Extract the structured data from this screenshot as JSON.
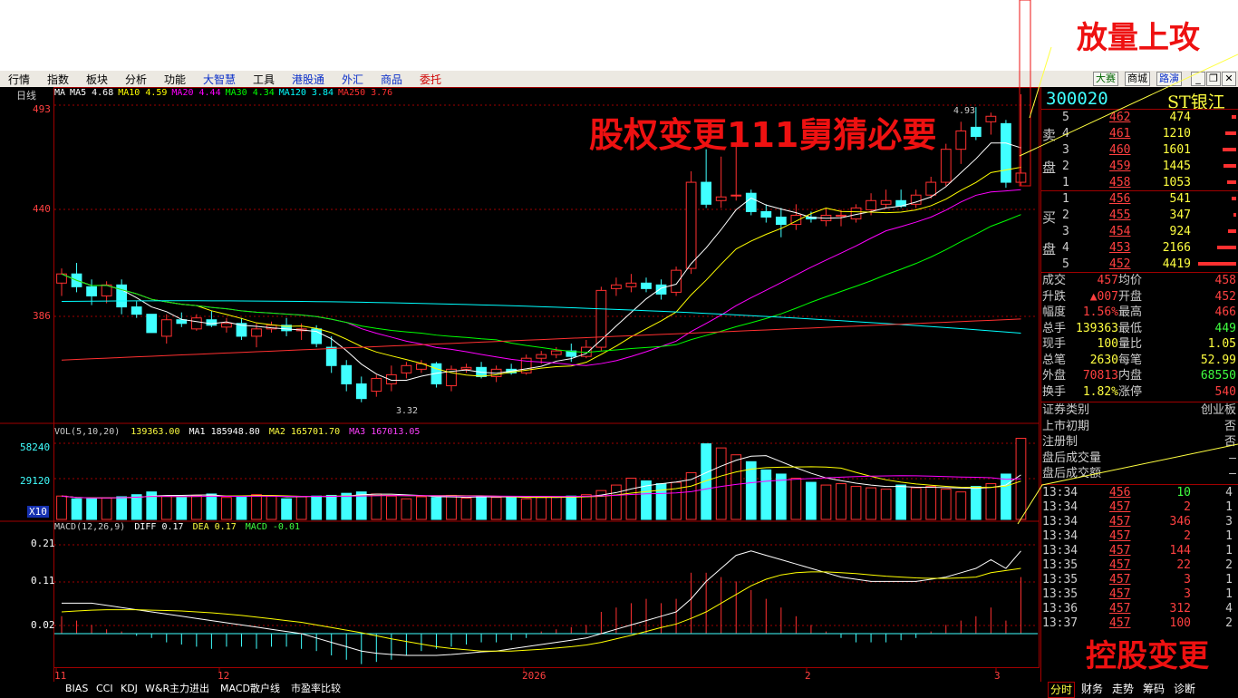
{
  "menu": {
    "items": [
      {
        "label": "行情",
        "style": "normal"
      },
      {
        "label": "指数",
        "style": "normal"
      },
      {
        "label": "板块",
        "style": "normal"
      },
      {
        "label": "分析",
        "style": "normal"
      },
      {
        "label": "功能",
        "style": "normal"
      },
      {
        "label": "大智慧",
        "style": "blue"
      },
      {
        "label": "工具",
        "style": "normal"
      },
      {
        "label": "港股通",
        "style": "blue"
      },
      {
        "label": "外汇",
        "style": "blue"
      },
      {
        "label": "商品",
        "style": "blue"
      },
      {
        "label": "委托",
        "style": "red"
      }
    ],
    "right_buttons": [
      "大赛",
      "商城",
      "路演"
    ],
    "window_controls": [
      "_",
      "❐",
      "✕"
    ]
  },
  "overlay": {
    "top_right": "放量上攻",
    "center": "股权变更111舅猜必要",
    "bottom_right": "控股变更"
  },
  "kline": {
    "period_label": "日线",
    "ma_legend": [
      {
        "label": "MA",
        "value": "",
        "color": "#ffffff"
      },
      {
        "label": "MA5",
        "value": "4.68",
        "color": "#ffffff"
      },
      {
        "label": "MA10",
        "value": "4.59",
        "color": "#ffff00"
      },
      {
        "label": "MA20",
        "value": "4.44",
        "color": "#ff00ff"
      },
      {
        "label": "MA30",
        "value": "4.34",
        "color": "#00ff00"
      },
      {
        "label": "MA120",
        "value": "3.84",
        "color": "#00ffff"
      },
      {
        "label": "MA250",
        "value": "3.76",
        "color": "#ff3030"
      }
    ],
    "price_ticks": [
      "493",
      "440",
      "386"
    ],
    "high_label": "4.93",
    "low_label": "3.32"
  },
  "volume": {
    "legend": {
      "title": "VOL(5,10,20)",
      "vol": "139363.00",
      "ma1_label": "MA1",
      "ma1": "185948.80",
      "ma2_label": "MA2",
      "ma2": "165701.70",
      "ma3_label": "MA3",
      "ma3": "167013.05"
    },
    "ticks": [
      "58240",
      "29120"
    ],
    "unit": "X10"
  },
  "macd": {
    "legend": {
      "title": "MACD(12,26,9)",
      "diff_label": "DIFF",
      "diff": "0.17",
      "dea_label": "DEA",
      "dea": "0.17",
      "macd_label": "MACD",
      "macd": "-0.01"
    },
    "ticks": [
      "0.21",
      "0.11",
      "0.02"
    ]
  },
  "x_axis": {
    "labels": [
      "11",
      "12",
      "2026",
      "2",
      "3"
    ]
  },
  "bottom_tabs": [
    "BIAS",
    "CCI",
    "KDJ",
    "W&R",
    "主力进出",
    "MACD",
    "散户线",
    "市盈率比较"
  ],
  "right_tabs": [
    "分时",
    "财务",
    "走势",
    "筹码",
    "诊断"
  ],
  "quote": {
    "code": "300020",
    "name": "ST银江",
    "sell_label": [
      "卖",
      "盘"
    ],
    "buy_label": [
      "买",
      "盘"
    ],
    "sell": [
      {
        "level": "5",
        "price": "462",
        "vol": "474"
      },
      {
        "level": "4",
        "price": "461",
        "vol": "1210"
      },
      {
        "level": "3",
        "price": "460",
        "vol": "1601"
      },
      {
        "level": "2",
        "price": "459",
        "vol": "1445"
      },
      {
        "level": "1",
        "price": "458",
        "vol": "1053"
      }
    ],
    "buy": [
      {
        "level": "1",
        "price": "456",
        "vol": "541"
      },
      {
        "level": "2",
        "price": "455",
        "vol": "347"
      },
      {
        "level": "3",
        "price": "454",
        "vol": "924"
      },
      {
        "level": "4",
        "price": "453",
        "vol": "2166"
      },
      {
        "level": "5",
        "price": "452",
        "vol": "4419"
      }
    ],
    "stats": [
      {
        "l1": "成交",
        "v1": "457",
        "l2": "均价",
        "v2": "458",
        "c1": "#ff4040",
        "c2": "#ff4040"
      },
      {
        "l1": "升跌",
        "v1": "▲007",
        "l2": "开盘",
        "v2": "452",
        "c1": "#ff4040",
        "c2": "#ff4040"
      },
      {
        "l1": "幅度",
        "v1": "1.56%",
        "l2": "最高",
        "v2": "466",
        "c1": "#ff4040",
        "c2": "#ff4040"
      },
      {
        "l1": "总手",
        "v1": "139363",
        "l2": "最低",
        "v2": "449",
        "c1": "#ffff40",
        "c2": "#40ff40"
      },
      {
        "l1": "现手",
        "v1": "100",
        "l2": "量比",
        "v2": "1.05",
        "c1": "#ffff40",
        "c2": "#ffff40"
      },
      {
        "l1": "总笔",
        "v1": "2630",
        "l2": "每笔",
        "v2": "52.99",
        "c1": "#ffff40",
        "c2": "#ffff40"
      },
      {
        "l1": "外盘",
        "v1": "70813",
        "l2": "内盘",
        "v2": "68550",
        "c1": "#ff4040",
        "c2": "#40ff40"
      },
      {
        "l1": "换手",
        "v1": "1.82%",
        "l2": "涨停",
        "v2": "540",
        "c1": "#ffff40",
        "c2": "#ff4040"
      }
    ],
    "info": [
      {
        "label": "证券类别",
        "value": "创业板"
      },
      {
        "label": "上市初期",
        "value": "否"
      },
      {
        "label": "注册制",
        "value": "否"
      },
      {
        "label": "盘后成交量",
        "value": "—"
      },
      {
        "label": "盘后成交额",
        "value": "—"
      }
    ],
    "ticks": [
      {
        "time": "13:34",
        "price": "456",
        "vol": "10",
        "n": "4"
      },
      {
        "time": "13:34",
        "price": "457",
        "vol": "2",
        "n": "1"
      },
      {
        "time": "13:34",
        "price": "457",
        "vol": "346",
        "n": "3"
      },
      {
        "time": "13:34",
        "price": "457",
        "vol": "2",
        "n": "1"
      },
      {
        "time": "13:34",
        "price": "457",
        "vol": "144",
        "n": "1"
      },
      {
        "time": "13:35",
        "price": "457",
        "vol": "22",
        "n": "2"
      },
      {
        "time": "13:35",
        "price": "457",
        "vol": "3",
        "n": "1"
      },
      {
        "time": "13:35",
        "price": "457",
        "vol": "3",
        "n": "1"
      },
      {
        "time": "13:36",
        "price": "457",
        "vol": "312",
        "n": "4"
      },
      {
        "time": "13:37",
        "price": "457",
        "vol": "100",
        "n": "2"
      }
    ]
  },
  "chart_data": {
    "type": "candlestick",
    "price_range": [
      3.2,
      5.0
    ],
    "candles": [
      {
        "o": 3.97,
        "h": 4.05,
        "l": 3.9,
        "c": 4.02
      },
      {
        "o": 4.02,
        "h": 4.08,
        "l": 3.92,
        "c": 3.95
      },
      {
        "o": 3.95,
        "h": 3.99,
        "l": 3.85,
        "c": 3.9
      },
      {
        "o": 3.9,
        "h": 3.98,
        "l": 3.86,
        "c": 3.96
      },
      {
        "o": 3.96,
        "h": 3.99,
        "l": 3.8,
        "c": 3.84
      },
      {
        "o": 3.84,
        "h": 3.87,
        "l": 3.78,
        "c": 3.8
      },
      {
        "o": 3.8,
        "h": 3.8,
        "l": 3.7,
        "c": 3.7
      },
      {
        "o": 3.68,
        "h": 3.8,
        "l": 3.64,
        "c": 3.77
      },
      {
        "o": 3.77,
        "h": 3.81,
        "l": 3.73,
        "c": 3.75
      },
      {
        "o": 3.72,
        "h": 3.8,
        "l": 3.71,
        "c": 3.78
      },
      {
        "o": 3.77,
        "h": 3.82,
        "l": 3.73,
        "c": 3.74
      },
      {
        "o": 3.73,
        "h": 3.78,
        "l": 3.7,
        "c": 3.75
      },
      {
        "o": 3.75,
        "h": 3.78,
        "l": 3.66,
        "c": 3.68
      },
      {
        "o": 3.68,
        "h": 3.75,
        "l": 3.62,
        "c": 3.72
      },
      {
        "o": 3.72,
        "h": 3.76,
        "l": 3.7,
        "c": 3.74
      },
      {
        "o": 3.74,
        "h": 3.78,
        "l": 3.68,
        "c": 3.71
      },
      {
        "o": 3.71,
        "h": 3.75,
        "l": 3.66,
        "c": 3.72
      },
      {
        "o": 3.72,
        "h": 3.74,
        "l": 3.62,
        "c": 3.64
      },
      {
        "o": 3.62,
        "h": 3.68,
        "l": 3.48,
        "c": 3.52
      },
      {
        "o": 3.52,
        "h": 3.55,
        "l": 3.38,
        "c": 3.42
      },
      {
        "o": 3.42,
        "h": 3.46,
        "l": 3.32,
        "c": 3.34
      },
      {
        "o": 3.38,
        "h": 3.47,
        "l": 3.35,
        "c": 3.45
      },
      {
        "o": 3.42,
        "h": 3.52,
        "l": 3.38,
        "c": 3.47
      },
      {
        "o": 3.48,
        "h": 3.54,
        "l": 3.45,
        "c": 3.52
      },
      {
        "o": 3.5,
        "h": 3.55,
        "l": 3.48,
        "c": 3.53
      },
      {
        "o": 3.53,
        "h": 3.54,
        "l": 3.4,
        "c": 3.42
      },
      {
        "o": 3.41,
        "h": 3.52,
        "l": 3.38,
        "c": 3.5
      },
      {
        "o": 3.5,
        "h": 3.53,
        "l": 3.48,
        "c": 3.51
      },
      {
        "o": 3.51,
        "h": 3.54,
        "l": 3.45,
        "c": 3.46
      },
      {
        "o": 3.46,
        "h": 3.52,
        "l": 3.43,
        "c": 3.5
      },
      {
        "o": 3.5,
        "h": 3.53,
        "l": 3.47,
        "c": 3.48
      },
      {
        "o": 3.48,
        "h": 3.58,
        "l": 3.47,
        "c": 3.56
      },
      {
        "o": 3.56,
        "h": 3.6,
        "l": 3.53,
        "c": 3.58
      },
      {
        "o": 3.58,
        "h": 3.62,
        "l": 3.56,
        "c": 3.6
      },
      {
        "o": 3.6,
        "h": 3.64,
        "l": 3.54,
        "c": 3.57
      },
      {
        "o": 3.57,
        "h": 3.66,
        "l": 3.56,
        "c": 3.62
      },
      {
        "o": 3.62,
        "h": 3.95,
        "l": 3.6,
        "c": 3.93
      },
      {
        "o": 3.94,
        "h": 4.0,
        "l": 3.9,
        "c": 3.96
      },
      {
        "o": 3.95,
        "h": 4.02,
        "l": 3.92,
        "c": 3.97
      },
      {
        "o": 3.97,
        "h": 4.0,
        "l": 3.92,
        "c": 3.94
      },
      {
        "o": 3.96,
        "h": 3.99,
        "l": 3.88,
        "c": 3.91
      },
      {
        "o": 3.92,
        "h": 4.06,
        "l": 3.9,
        "c": 4.04
      },
      {
        "o": 4.05,
        "h": 4.58,
        "l": 4.02,
        "c": 4.52
      },
      {
        "o": 4.52,
        "h": 4.7,
        "l": 4.38,
        "c": 4.4
      },
      {
        "o": 4.42,
        "h": 4.66,
        "l": 4.38,
        "c": 4.44
      },
      {
        "o": 4.45,
        "h": 4.72,
        "l": 4.42,
        "c": 4.45
      },
      {
        "o": 4.46,
        "h": 4.48,
        "l": 4.34,
        "c": 4.36
      },
      {
        "o": 4.36,
        "h": 4.4,
        "l": 4.3,
        "c": 4.33
      },
      {
        "o": 4.33,
        "h": 4.38,
        "l": 4.22,
        "c": 4.29
      },
      {
        "o": 4.29,
        "h": 4.4,
        "l": 4.26,
        "c": 4.34
      },
      {
        "o": 4.33,
        "h": 4.36,
        "l": 4.3,
        "c": 4.32
      },
      {
        "o": 4.31,
        "h": 4.38,
        "l": 4.28,
        "c": 4.34
      },
      {
        "o": 4.34,
        "h": 4.37,
        "l": 4.28,
        "c": 4.34
      },
      {
        "o": 4.32,
        "h": 4.4,
        "l": 4.3,
        "c": 4.38
      },
      {
        "o": 4.37,
        "h": 4.46,
        "l": 4.34,
        "c": 4.42
      },
      {
        "o": 4.4,
        "h": 4.48,
        "l": 4.38,
        "c": 4.42
      },
      {
        "o": 4.42,
        "h": 4.48,
        "l": 4.38,
        "c": 4.39
      },
      {
        "o": 4.4,
        "h": 4.48,
        "l": 4.38,
        "c": 4.45
      },
      {
        "o": 4.45,
        "h": 4.55,
        "l": 4.43,
        "c": 4.52
      },
      {
        "o": 4.52,
        "h": 4.73,
        "l": 4.5,
        "c": 4.7
      },
      {
        "o": 4.7,
        "h": 4.85,
        "l": 4.62,
        "c": 4.8
      },
      {
        "o": 4.82,
        "h": 4.93,
        "l": 4.75,
        "c": 4.77
      },
      {
        "o": 4.85,
        "h": 4.9,
        "l": 4.78,
        "c": 4.88
      },
      {
        "o": 4.84,
        "h": 4.86,
        "l": 4.49,
        "c": 4.52
      },
      {
        "o": 4.52,
        "h": 5.0,
        "l": 4.5,
        "c": 4.57
      }
    ],
    "volume": [
      170,
      150,
      150,
      155,
      165,
      180,
      200,
      170,
      160,
      175,
      185,
      160,
      165,
      180,
      170,
      150,
      165,
      170,
      175,
      190,
      200,
      185,
      170,
      150,
      165,
      160,
      175,
      155,
      170,
      160,
      165,
      150,
      160,
      165,
      170,
      180,
      210,
      250,
      300,
      280,
      260,
      270,
      340,
      550,
      520,
      470,
      420,
      360,
      330,
      300,
      270,
      250,
      260,
      240,
      230,
      220,
      250,
      230,
      240,
      220,
      200,
      240,
      260,
      330,
      590
    ],
    "macd_hist": [
      0.04,
      0.03,
      0.02,
      0.01,
      0.005,
      -0.005,
      -0.01,
      -0.02,
      -0.025,
      -0.03,
      -0.035,
      -0.03,
      -0.03,
      -0.035,
      -0.03,
      -0.03,
      -0.035,
      -0.04,
      -0.05,
      -0.06,
      -0.07,
      -0.065,
      -0.06,
      -0.05,
      -0.04,
      -0.035,
      -0.03,
      -0.025,
      -0.02,
      -0.02,
      -0.015,
      -0.01,
      0.005,
      0.01,
      0.015,
      0.02,
      0.05,
      0.06,
      0.07,
      0.08,
      0.07,
      0.08,
      0.14,
      0.14,
      0.13,
      0.12,
      0.1,
      0.08,
      0.06,
      0.04,
      0.02,
      0.005,
      -0.01,
      -0.02,
      -0.02,
      -0.02,
      -0.015,
      -0.01,
      0.005,
      0.02,
      0.03,
      0.04,
      0.06,
      0.03,
      0.13
    ],
    "macd_diff": [
      0.07,
      0.07,
      0.07,
      0.065,
      0.06,
      0.055,
      0.05,
      0.045,
      0.04,
      0.035,
      0.03,
      0.025,
      0.02,
      0.015,
      0.01,
      0.005,
      0.0,
      -0.01,
      -0.02,
      -0.03,
      -0.04,
      -0.045,
      -0.048,
      -0.05,
      -0.05,
      -0.05,
      -0.048,
      -0.045,
      -0.042,
      -0.04,
      -0.035,
      -0.03,
      -0.025,
      -0.02,
      -0.015,
      -0.01,
      0.0,
      0.01,
      0.02,
      0.03,
      0.04,
      0.05,
      0.08,
      0.12,
      0.15,
      0.18,
      0.19,
      0.18,
      0.17,
      0.16,
      0.15,
      0.14,
      0.13,
      0.125,
      0.12,
      0.12,
      0.12,
      0.12,
      0.125,
      0.13,
      0.14,
      0.15,
      0.17,
      0.15,
      0.19
    ],
    "macd_dea": [
      0.05,
      0.052,
      0.054,
      0.055,
      0.055,
      0.055,
      0.054,
      0.053,
      0.052,
      0.05,
      0.048,
      0.045,
      0.042,
      0.038,
      0.034,
      0.03,
      0.026,
      0.02,
      0.014,
      0.008,
      0.002,
      -0.005,
      -0.012,
      -0.018,
      -0.024,
      -0.03,
      -0.034,
      -0.037,
      -0.04,
      -0.04,
      -0.04,
      -0.038,
      -0.036,
      -0.033,
      -0.03,
      -0.026,
      -0.02,
      -0.012,
      -0.004,
      0.005,
      0.014,
      0.022,
      0.035,
      0.05,
      0.07,
      0.09,
      0.11,
      0.125,
      0.135,
      0.14,
      0.142,
      0.142,
      0.14,
      0.138,
      0.135,
      0.132,
      0.13,
      0.128,
      0.127,
      0.127,
      0.128,
      0.13,
      0.14,
      0.145,
      0.15
    ]
  }
}
